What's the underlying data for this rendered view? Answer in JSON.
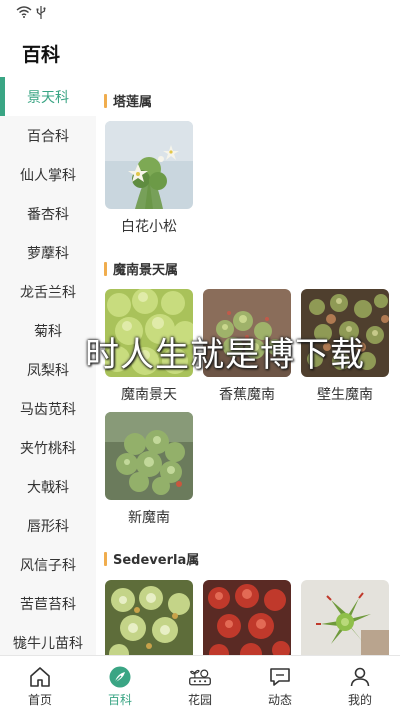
{
  "page": {
    "title": "百科"
  },
  "sidebar": {
    "items": [
      {
        "label": "景天科",
        "active": true
      },
      {
        "label": "百合科"
      },
      {
        "label": "仙人掌科"
      },
      {
        "label": "番杏科"
      },
      {
        "label": "萝藦科"
      },
      {
        "label": "龙舌兰科"
      },
      {
        "label": "菊科"
      },
      {
        "label": "凤梨科"
      },
      {
        "label": "马齿苋科"
      },
      {
        "label": "夹竹桃科"
      },
      {
        "label": "大戟科"
      },
      {
        "label": "唇形科"
      },
      {
        "label": "风信子科"
      },
      {
        "label": "苦苣苔科"
      },
      {
        "label": "牻牛儿苗科"
      }
    ]
  },
  "sections": [
    {
      "title": "塔莲属",
      "plants": [
        {
          "name": "白花小松",
          "icon": "succulent-photo"
        }
      ]
    },
    {
      "title": "魔南景天属",
      "plants": [
        {
          "name": "魔南景天",
          "icon": "succulent-photo"
        },
        {
          "name": "香蕉魔南",
          "icon": "succulent-photo"
        },
        {
          "name": "壁生魔南",
          "icon": "succulent-photo"
        },
        {
          "name": "新魔南",
          "icon": "succulent-photo"
        }
      ]
    },
    {
      "title": "Sedeverla属",
      "plants": [
        {
          "name": "",
          "icon": "succulent-photo"
        },
        {
          "name": "",
          "icon": "succulent-photo"
        },
        {
          "name": "",
          "icon": "succulent-photo"
        }
      ]
    }
  ],
  "overlay": {
    "text": "时人生就是博下载"
  },
  "tabbar": {
    "tabs": [
      {
        "label": "首页",
        "icon": "home-icon"
      },
      {
        "label": "百科",
        "icon": "encyclopedia-icon",
        "active": true
      },
      {
        "label": "花园",
        "icon": "garden-icon"
      },
      {
        "label": "动态",
        "icon": "chat-icon"
      },
      {
        "label": "我的",
        "icon": "user-icon"
      }
    ]
  },
  "colors": {
    "accent": "#3aa584",
    "section_marker": "#f0ad4e",
    "sidebar_bg": "#f7f7f7"
  }
}
